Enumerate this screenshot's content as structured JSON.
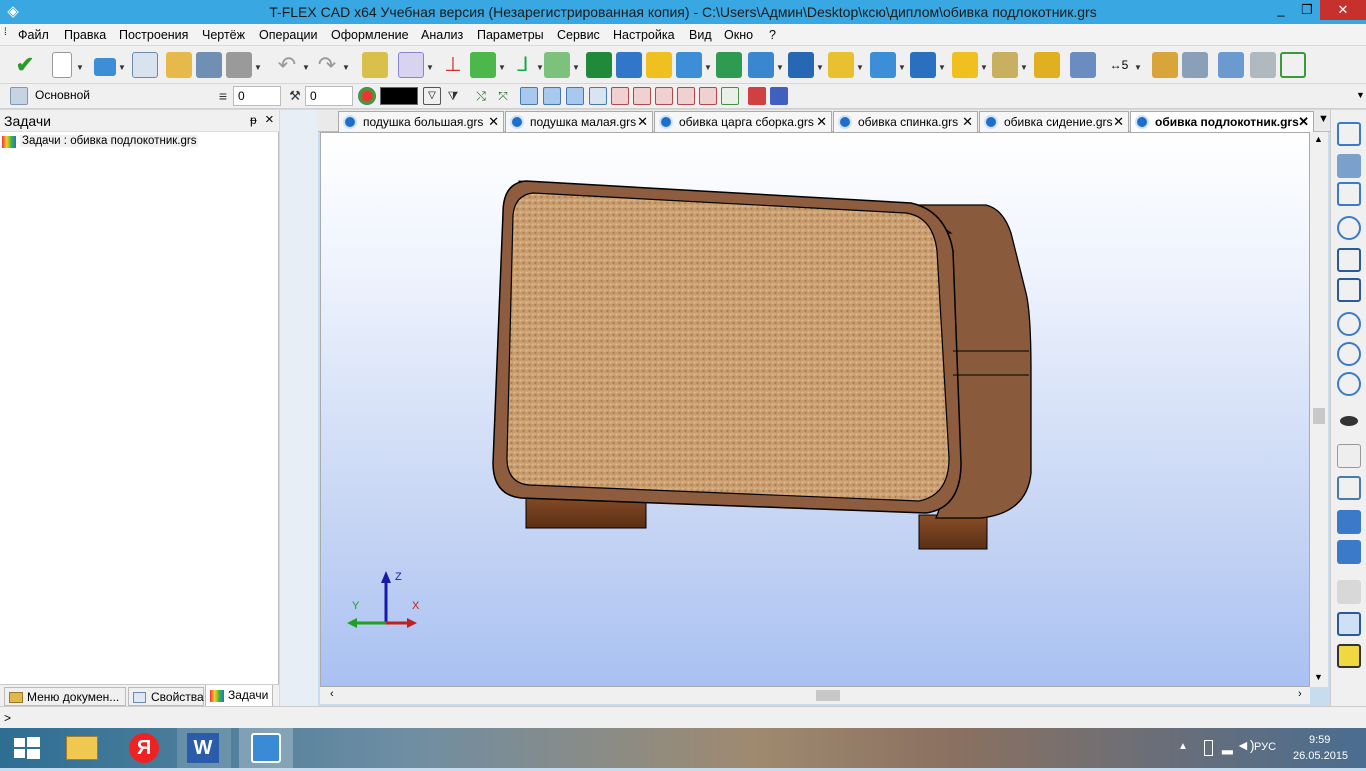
{
  "window": {
    "title": "T-FLEX CAD x64 Учебная версия (Незарегистрированная копия) - C:\\Users\\Админ\\Desktop\\ксю\\диплом\\обивка подлокотник.grs",
    "minimize": "_",
    "maximize": "❐",
    "close": "✕"
  },
  "menu": [
    "Файл",
    "Правка",
    "Построения",
    "Чертёж",
    "Операции",
    "Оформление",
    "Анализ",
    "Параметры",
    "Сервис",
    "Настройка",
    "Вид",
    "Окно",
    "?"
  ],
  "toolbar2": {
    "layer_name": "Основной",
    "level_value": "0",
    "priority_value": "0"
  },
  "left_panel": {
    "title": "Задачи",
    "pin": "ᵽ",
    "close": "×",
    "tree_item": "Задачи : обивка подлокотник.grs",
    "bottom_tabs": [
      "Меню докумен...",
      "Свойства",
      "Задачи"
    ]
  },
  "doc_tabs": [
    {
      "label": "подушка большая.grs",
      "active": false
    },
    {
      "label": "подушка малая.grs",
      "active": false
    },
    {
      "label": "обивка царга сборка.grs",
      "active": false
    },
    {
      "label": "обивка спинка.grs",
      "active": false
    },
    {
      "label": "обивка сидение.grs",
      "active": false
    },
    {
      "label": "обивка подлокотник.grs",
      "active": true
    }
  ],
  "axes": {
    "x": "X",
    "y": "Y",
    "z": "Z"
  },
  "status": {
    "prompt": ">"
  },
  "taskbar": {
    "time": "9:59",
    "date": "26.05.2015",
    "lang": "РУС"
  },
  "colors": {
    "title_bar": "#39a8e2",
    "close_button": "#c7312d",
    "fabric": "#c99c6e",
    "leather": "#8a5a3c",
    "wood": "#6e3c1c"
  }
}
